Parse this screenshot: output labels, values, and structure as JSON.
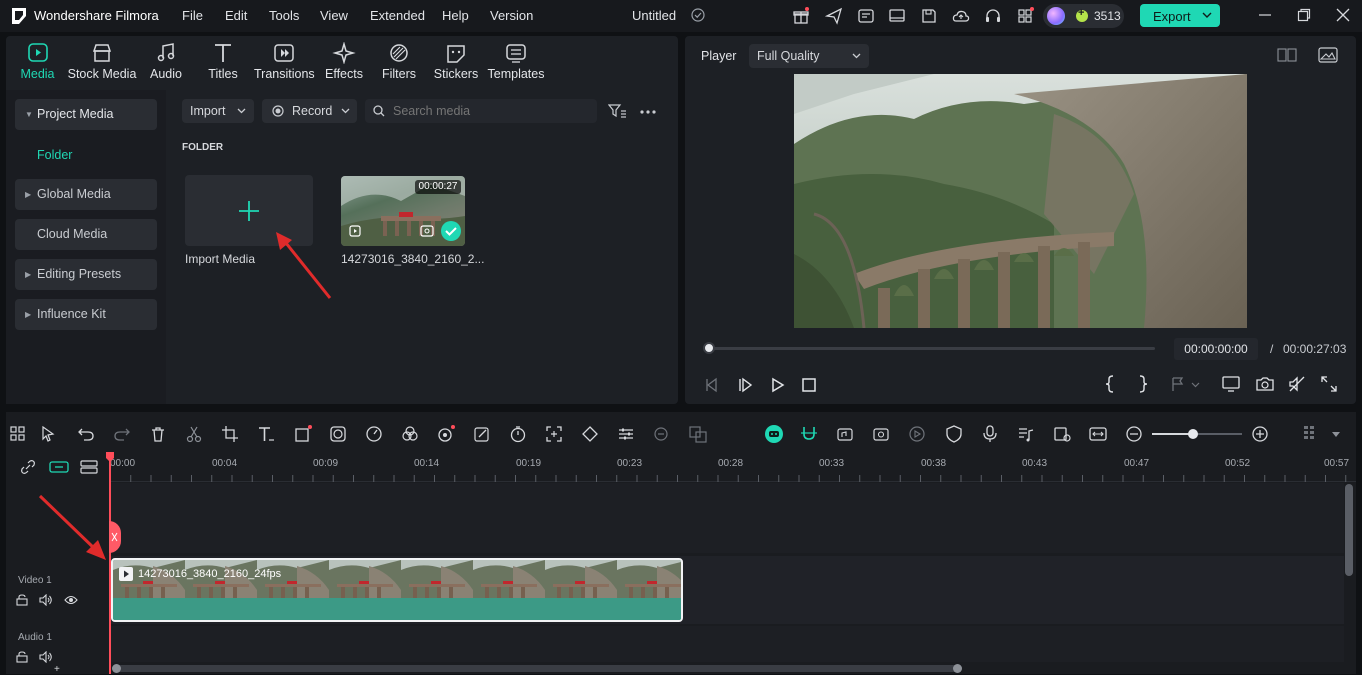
{
  "app": {
    "name": "Wondershare Filmora",
    "project_title": "Untitled"
  },
  "menu": [
    "File",
    "Edit",
    "Tools",
    "View",
    "Extended",
    "Help",
    "Version"
  ],
  "header": {
    "credits": "3513",
    "export_label": "Export",
    "accent": "#1fd8b4"
  },
  "media_tabs": [
    "Media",
    "Stock Media",
    "Audio",
    "Titles",
    "Transitions",
    "Effects",
    "Filters",
    "Stickers",
    "Templates"
  ],
  "sidebar": {
    "items": [
      {
        "label": "Project Media"
      },
      {
        "label": "Folder"
      },
      {
        "label": "Global Media"
      },
      {
        "label": "Cloud Media"
      },
      {
        "label": "Editing Presets"
      },
      {
        "label": "Influence Kit"
      }
    ]
  },
  "media_toolbar": {
    "import_label": "Import",
    "record_label": "Record",
    "search_placeholder": "Search media"
  },
  "media": {
    "section_label": "FOLDER",
    "import_tile_label": "Import Media",
    "clip": {
      "name": "14273016_3840_2160_2...",
      "duration": "00:00:27"
    }
  },
  "player": {
    "label": "Player",
    "quality": "Full Quality",
    "current_time": "00:00:00:00",
    "separator": "/",
    "total_time": "00:00:27:03"
  },
  "timeline": {
    "ruler": [
      "00:00",
      "00:04",
      "00:09",
      "00:14",
      "00:19",
      "00:23",
      "00:28",
      "00:33",
      "00:38",
      "00:43",
      "00:47",
      "00:52",
      "00:57"
    ],
    "tracks": {
      "video": "Video 1",
      "audio": "Audio 1"
    },
    "clip_name": "14273016_3840_2160_24fps",
    "zoom_level": 0.45
  }
}
